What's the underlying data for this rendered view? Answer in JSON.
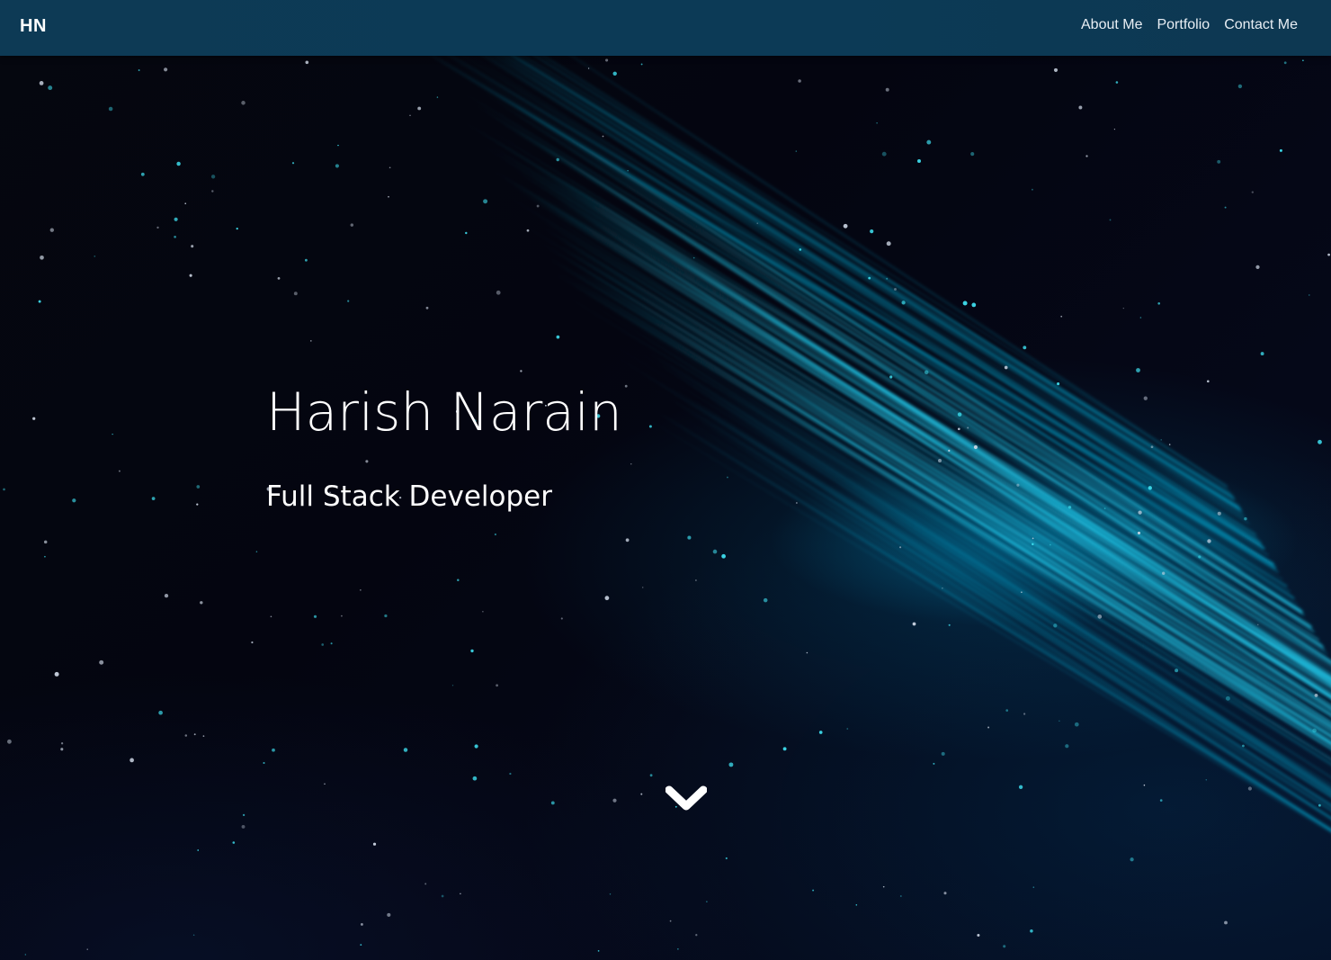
{
  "navbar": {
    "brand": "HN",
    "links": [
      {
        "label": "About Me"
      },
      {
        "label": "Portfolio"
      },
      {
        "label": "Contact Me"
      }
    ]
  },
  "hero": {
    "name": "Harish Narain",
    "role": "Full Stack Developer",
    "scroll_icon": "chevron-down-icon"
  },
  "colors": {
    "navbar_bg": "#0c3a56",
    "accent": "#1ab8d8",
    "text": "#ffffff"
  }
}
